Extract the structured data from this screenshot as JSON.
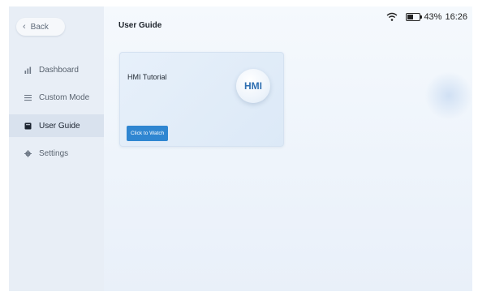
{
  "nav": {
    "back_label": "Back",
    "items": [
      {
        "label": "Dashboard",
        "icon": "bar-chart-icon"
      },
      {
        "label": "Custom Mode",
        "icon": "list-icon"
      },
      {
        "label": "User Guide",
        "icon": "book-icon",
        "active": true
      },
      {
        "label": "Settings",
        "icon": "gear-icon"
      }
    ]
  },
  "header": {
    "title": "User Guide"
  },
  "status": {
    "battery_percent": "43%",
    "time": "16:26",
    "battery_level": 0.43
  },
  "card": {
    "title": "HMI Tutorial",
    "badge": "HMI",
    "button_label": "Click to Watch"
  },
  "colors": {
    "accent": "#2f86d1",
    "badge_text": "#2f6fb1",
    "active_nav_bg": "#d9e2ee"
  }
}
